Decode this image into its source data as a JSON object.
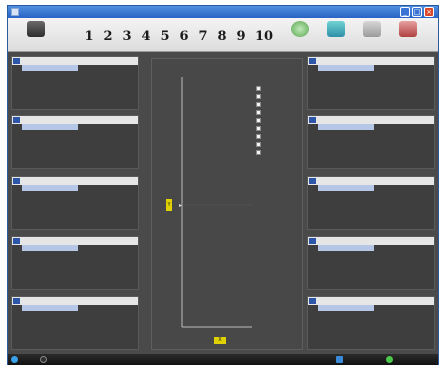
{
  "window": {
    "title": ""
  },
  "toolbar": {
    "connect_label": "",
    "start_label": "",
    "chart_label": "",
    "setup_label": "",
    "exit_label": "",
    "stations": [
      "1",
      "2",
      "3",
      "4",
      "5",
      "6",
      "7",
      "8",
      "9",
      "10"
    ]
  },
  "panel_header": {
    "name": "",
    "temp": "",
    "set": "",
    "state": ""
  },
  "left_panels": [
    {
      "number": "",
      "row_text": ""
    },
    {
      "number": "",
      "row_text": ""
    },
    {
      "number": "",
      "row_text": ""
    },
    {
      "number": "",
      "row_text": ""
    },
    {
      "number": "",
      "row_text": ""
    }
  ],
  "right_panels": [
    {
      "number": "",
      "row_text": ""
    },
    {
      "number": "",
      "row_text": ""
    },
    {
      "number": "",
      "row_text": ""
    },
    {
      "number": "",
      "row_text": ""
    },
    {
      "number": "",
      "row_text": ""
    }
  ],
  "chart": {
    "title": "",
    "y_axis_label": "Y",
    "x_axis_label": "X",
    "legend": [
      {
        "label": "",
        "color": "#6ad36a"
      },
      {
        "label": "",
        "color": "#e0e0e0"
      },
      {
        "label": "",
        "color": "#4cc84c"
      },
      {
        "label": "",
        "color": "#8fb4ff"
      },
      {
        "label": "",
        "color": "#5aa0f0"
      },
      {
        "label": "",
        "color": "#e07a30"
      },
      {
        "label": "",
        "color": "#d8d8d8"
      },
      {
        "label": "",
        "color": "#9a9a9a"
      },
      {
        "label": "",
        "color": "#6ad36a"
      }
    ]
  },
  "statusbar": {
    "connection": "",
    "message": "",
    "indicator_a": "",
    "indicator_b": ""
  },
  "colors": {
    "accent_blue": "#2d55a8",
    "axis_yellow": "#e0d200",
    "background": "#4a4a4a"
  }
}
